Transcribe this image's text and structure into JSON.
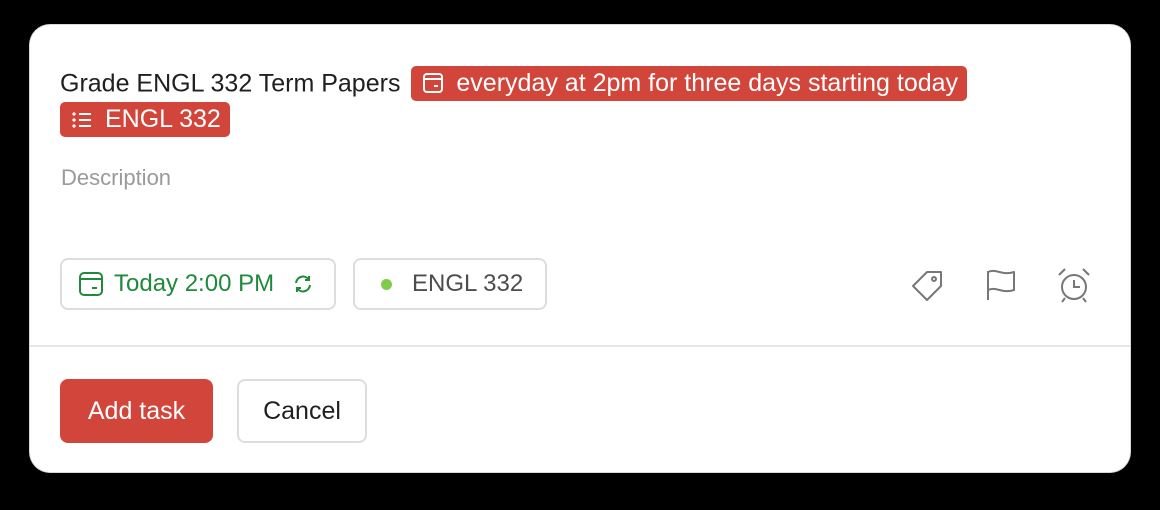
{
  "task": {
    "title": "Grade ENGL 332 Term Papers",
    "schedule_chip": "everyday at 2pm for three days starting today",
    "project_chip": "ENGL 332",
    "description_placeholder": "Description"
  },
  "options": {
    "due_date": "Today 2:00 PM",
    "project": "ENGL 332",
    "tools": [
      "tag-icon",
      "flag-icon",
      "alarm-clock-icon"
    ]
  },
  "actions": {
    "add_label": "Add task",
    "cancel_label": "Cancel"
  },
  "colors": {
    "accent": "#d1453b",
    "date_green": "#208a3c",
    "project_dot": "#7ecc49"
  }
}
